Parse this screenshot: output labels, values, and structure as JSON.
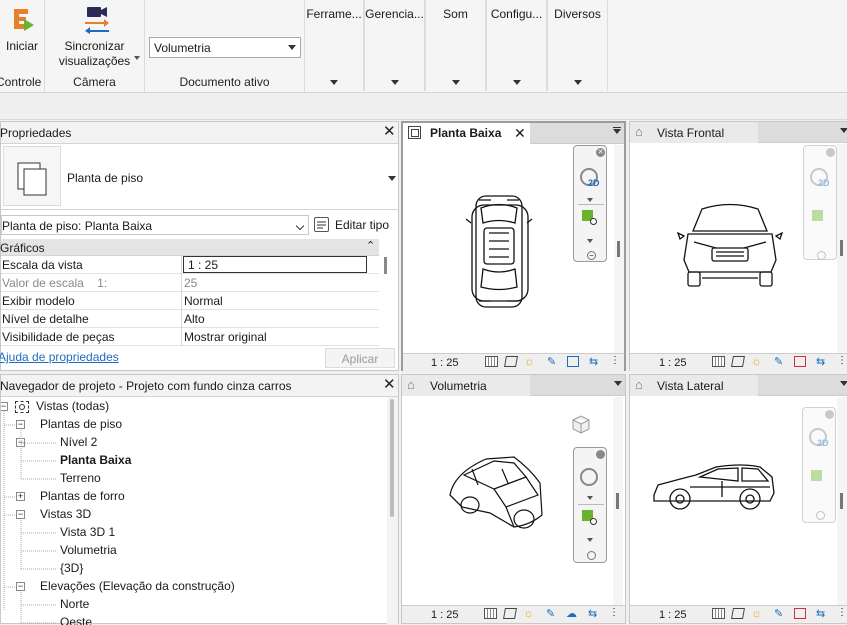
{
  "ribbon": {
    "start_label": "Iniciar",
    "control_label": "Controle",
    "sync_label_1": "Sincronizar",
    "sync_label_2": "visualizações",
    "camera_label": "Câmera",
    "doc_select_value": "Volumetria",
    "doc_group_label": "Documento ativo",
    "tabs": [
      "Ferrame...",
      "Gerencia...",
      "Som",
      "Configu...",
      "Diversos"
    ]
  },
  "properties": {
    "title": "Propriedades",
    "type_name": "Planta de piso",
    "instance_select": "Planta de piso: Planta Baixa",
    "edit_type_label": "Editar tipo",
    "section_label": "Gráficos",
    "rows": [
      {
        "k": "Escala da vista",
        "v": "1 : 25"
      },
      {
        "k": "Valor de escala    1:",
        "v": "25"
      },
      {
        "k": "Exibir modelo",
        "v": "Normal"
      },
      {
        "k": "Nível de detalhe",
        "v": "Alto"
      },
      {
        "k": "Visibilidade de peças",
        "v": "Mostrar original"
      }
    ],
    "help_link": "Ajuda de propriedades",
    "apply_label": "Aplicar"
  },
  "browser": {
    "title": "Navegador de projeto - Projeto com fundo cinza carros",
    "items": [
      {
        "label": "Vistas (todas)"
      },
      {
        "label": "Plantas de piso"
      },
      {
        "label": "Nível 2"
      },
      {
        "label": "Planta Baixa"
      },
      {
        "label": "Terreno"
      },
      {
        "label": "Plantas de forro"
      },
      {
        "label": "Vistas 3D"
      },
      {
        "label": "Vista 3D 1"
      },
      {
        "label": "Volumetria"
      },
      {
        "label": "{3D}"
      },
      {
        "label": "Elevações (Elevação da construção)"
      },
      {
        "label": "Norte"
      },
      {
        "label": "Oeste"
      }
    ]
  },
  "views": [
    {
      "title": "Planta Baixa",
      "scale": "1 : 25"
    },
    {
      "title": "Vista Frontal",
      "scale": "1 : 25"
    },
    {
      "title": "Volumetria",
      "scale": "1 : 25"
    },
    {
      "title": "Vista Lateral",
      "scale": "1 : 25"
    }
  ],
  "nav_label": "2D",
  "colors": {
    "accent": "#1e6cc0",
    "logo_orange": "#e8802a",
    "logo_green": "#6ab42d"
  }
}
